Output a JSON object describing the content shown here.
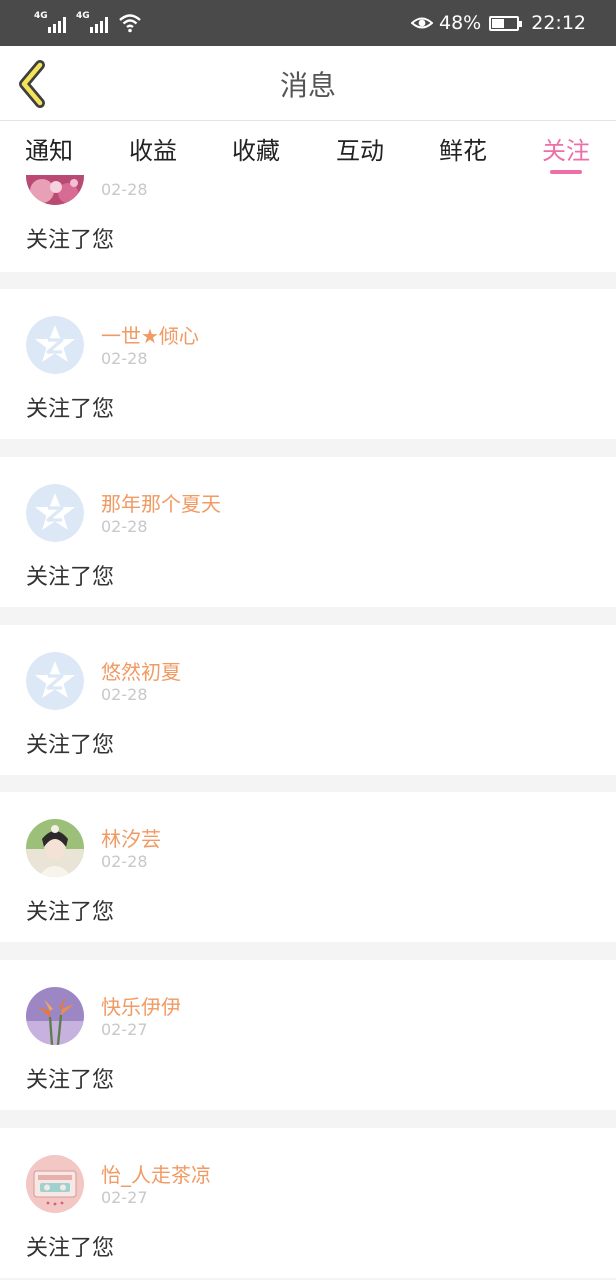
{
  "status_bar": {
    "network_1": "4G",
    "network_2": "4G",
    "battery_percent": "48%",
    "time": "22:12"
  },
  "header": {
    "title": "消息",
    "back_icon": "chevron-left-icon"
  },
  "tabs": [
    {
      "label": "通知",
      "active": false
    },
    {
      "label": "收益",
      "active": false
    },
    {
      "label": "收藏",
      "active": false
    },
    {
      "label": "互动",
      "active": false
    },
    {
      "label": "鲜花",
      "active": false
    },
    {
      "label": "关注",
      "active": true
    }
  ],
  "colors": {
    "accent": "#ee6ea8",
    "username": "#f19a63",
    "date": "#c8c8c8",
    "statusbar": "#4a4a4a"
  },
  "notifications": [
    {
      "user": "",
      "date": "02-28",
      "text": "关注了您",
      "avatar": "photo-pink"
    },
    {
      "user": "一世★倾心",
      "date": "02-28",
      "text": "关注了您",
      "avatar": "default-star-avatar-icon"
    },
    {
      "user": "那年那个夏天",
      "date": "02-28",
      "text": "关注了您",
      "avatar": "default-star-avatar-icon"
    },
    {
      "user": "悠然初夏",
      "date": "02-28",
      "text": "关注了您",
      "avatar": "default-star-avatar-icon"
    },
    {
      "user": "林汐芸",
      "date": "02-28",
      "text": "关注了您",
      "avatar": "photo-portrait"
    },
    {
      "user": "快乐伊伊",
      "date": "02-27",
      "text": "关注了您",
      "avatar": "photo-flowers"
    },
    {
      "user": "怡_人走茶凉",
      "date": "02-27",
      "text": "关注了您",
      "avatar": "photo-cassette"
    }
  ]
}
